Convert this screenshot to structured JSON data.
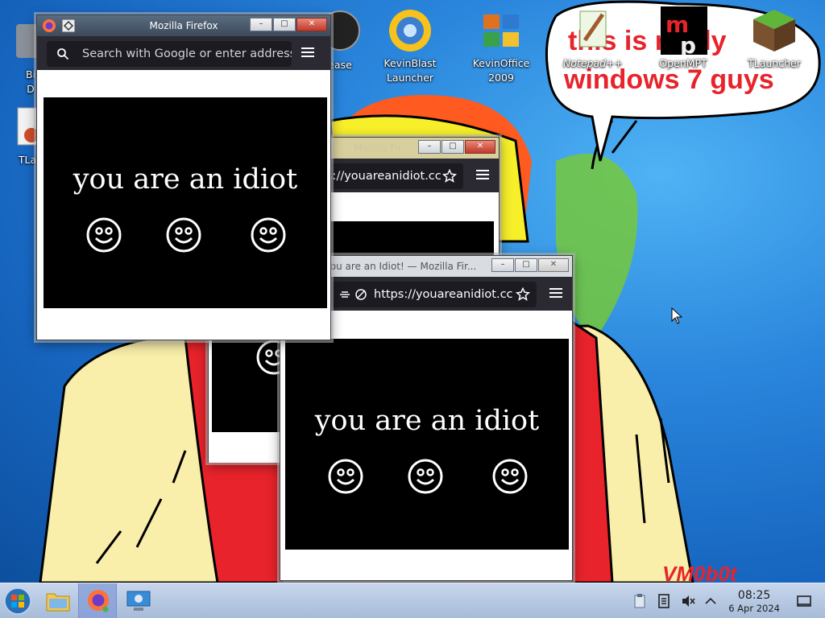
{
  "desktop": {
    "icons": [
      {
        "label": "Bi",
        "label2": "D"
      },
      {
        "label": "TLau"
      },
      {
        "label": "ease"
      },
      {
        "label": "KevinBlast",
        "label2": "Launcher"
      },
      {
        "label": "KevinOffice",
        "label2": "2009"
      },
      {
        "label": "Notepad++"
      },
      {
        "label": "OpenMPT"
      },
      {
        "label": "TLauncher"
      }
    ],
    "wallpaper": {
      "speech_line1": "this is really",
      "speech_line2": "windows 7 guys",
      "signature": "VM0b0t"
    }
  },
  "windows": {
    "front": {
      "title": "Mozilla Firefox",
      "url_placeholder": "Search with Google or enter address",
      "content_text": "you are an idiot"
    },
    "middle": {
      "title": "Mozilla Fir",
      "url_text": "s://youareanidiot.cc"
    },
    "bottom": {
      "title": "You are an Idiot! — Mozilla Fir...",
      "url_text": "https://youareanidiot.cc",
      "content_text": "you are an idiot"
    }
  },
  "taskbar": {
    "clock_time": "08:25",
    "clock_date": "6 Apr 2024"
  },
  "colors": {
    "taskbar_bg": "#b8cbe6",
    "firefox_toolbar": "#2b2a33",
    "idiot_bg": "#000000",
    "wallpaper_red": "#e8232b"
  }
}
